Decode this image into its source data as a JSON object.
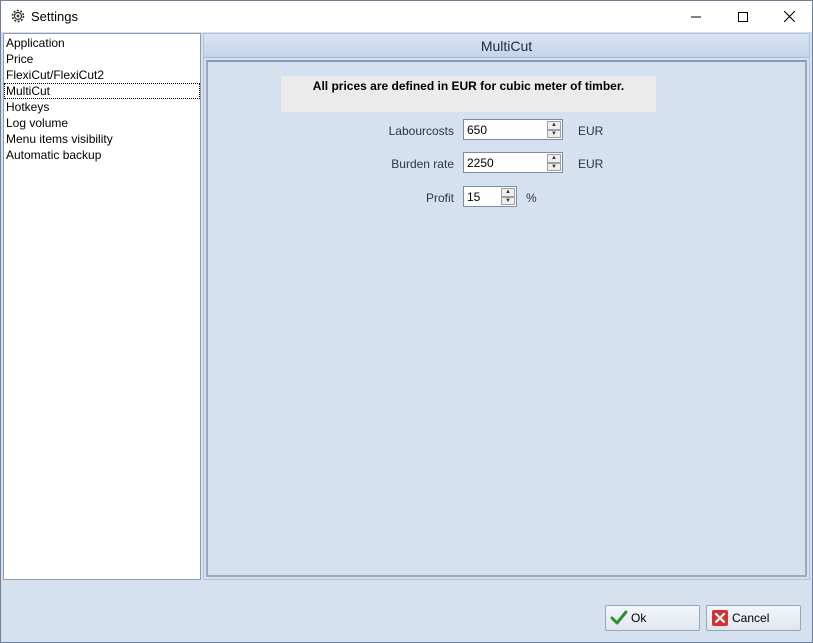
{
  "window": {
    "title": "Settings"
  },
  "nav": {
    "items": [
      {
        "label": "Application"
      },
      {
        "label": "Price"
      },
      {
        "label": "FlexiCut/FlexiCut2"
      },
      {
        "label": "MultiCut"
      },
      {
        "label": "Hotkeys"
      },
      {
        "label": "Log volume"
      },
      {
        "label": "Menu items visibility"
      },
      {
        "label": "Automatic backup"
      }
    ],
    "selected": "MultiCut"
  },
  "panel": {
    "title": "MultiCut",
    "notice": "All prices are defined in EUR for cubic meter of timber.",
    "fields": {
      "labourcosts": {
        "label": "Labourcosts",
        "value": "650",
        "unit": "EUR"
      },
      "burden_rate": {
        "label": "Burden rate",
        "value": "2250",
        "unit": "EUR"
      },
      "profit": {
        "label": "Profit",
        "value": "15",
        "unit": "%"
      }
    }
  },
  "buttons": {
    "ok": "Ok",
    "cancel": "Cancel"
  },
  "icons": {
    "app": "gear-icon",
    "minimize": "minimize-icon",
    "maximize": "maximize-icon",
    "close": "close-icon",
    "ok": "checkmark-icon",
    "cancel": "cancel-x-icon"
  }
}
